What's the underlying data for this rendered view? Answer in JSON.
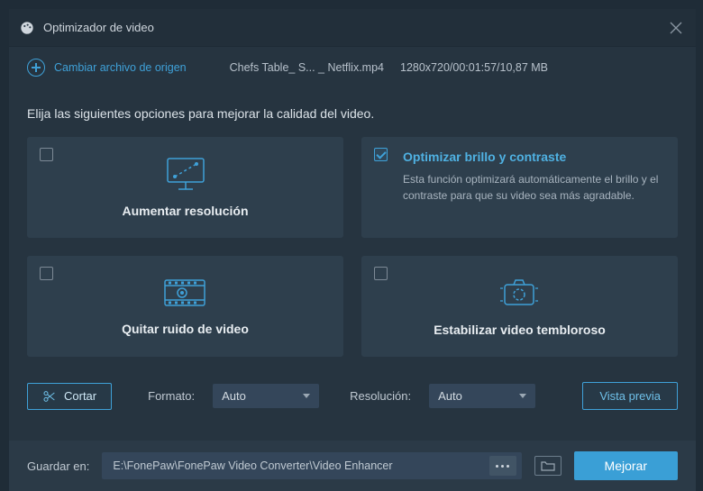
{
  "title": "Optimizador de video",
  "change_source_label": "Cambiar archivo de origen",
  "filename": "Chefs Table_ S... _ Netflix.mp4",
  "filemeta": "1280x720/00:01:57/10,87 MB",
  "instructions": "Elija las siguientes opciones para mejorar la calidad del video.",
  "cards": {
    "upscale": {
      "title": "Aumentar resolución"
    },
    "bright": {
      "title": "Optimizar brillo y contraste",
      "desc": "Esta función optimizará automáticamente el brillo y el contraste para que su video sea más agradable."
    },
    "denoise": {
      "title": "Quitar ruido de video"
    },
    "stabilize": {
      "title": "Estabilizar video tembloroso"
    }
  },
  "cut_label": "Cortar",
  "format_label": "Formato:",
  "format_value": "Auto",
  "resolution_label": "Resolución:",
  "resolution_value": "Auto",
  "preview_label": "Vista previa",
  "save_in_label": "Guardar en:",
  "save_path": "E:\\FonePaw\\FonePaw Video Converter\\Video Enhancer",
  "enhance_label": "Mejorar"
}
